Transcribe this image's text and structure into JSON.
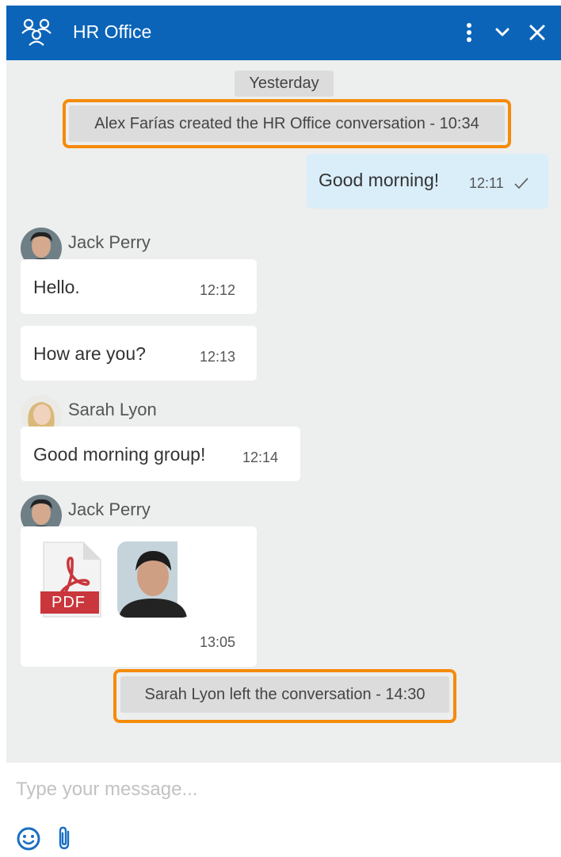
{
  "header": {
    "title": "HR Office",
    "icon": "group-icon",
    "accent_color": "#0b64b8"
  },
  "day_separator": "Yesterday",
  "system_events": [
    {
      "text": "Alex Farías created the HR Office conversation - 10:34"
    },
    {
      "text": "Sarah Lyon left the conversation - 14:30"
    }
  ],
  "highlight_color": "#f58b0a",
  "outgoing": {
    "text": "Good morning!",
    "time": "12:11",
    "status_icon": "check-icon"
  },
  "groups": [
    {
      "sender": "Jack Perry",
      "messages": [
        {
          "text": "Hello.",
          "time": "12:12"
        },
        {
          "text": "How are you?",
          "time": "12:13"
        }
      ]
    },
    {
      "sender": "Sarah Lyon",
      "messages": [
        {
          "text": "Good morning group!",
          "time": "12:14"
        }
      ]
    },
    {
      "sender": "Jack Perry",
      "attachments": [
        {
          "type": "pdf",
          "label": "PDF"
        },
        {
          "type": "image"
        }
      ],
      "time": "13:05"
    }
  ],
  "composer": {
    "placeholder": "Type your message...",
    "tools": [
      "emoji-icon",
      "paperclip-icon"
    ]
  }
}
